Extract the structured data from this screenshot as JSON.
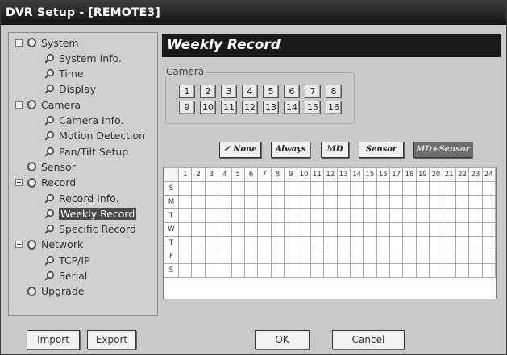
{
  "window": {
    "title": "DVR Setup - [REMOTE3]"
  },
  "tree": {
    "items": [
      {
        "label": "System",
        "level": 0,
        "expander": true,
        "icon": "folder-icon"
      },
      {
        "label": "System Info.",
        "level": 1,
        "icon": "magnifier-icon"
      },
      {
        "label": "Time",
        "level": 1,
        "icon": "magnifier-icon"
      },
      {
        "label": "Display",
        "level": 1,
        "icon": "magnifier-icon"
      },
      {
        "label": "Camera",
        "level": 0,
        "expander": true,
        "icon": "folder-icon"
      },
      {
        "label": "Camera Info.",
        "level": 1,
        "icon": "magnifier-icon"
      },
      {
        "label": "Motion Detection",
        "level": 1,
        "icon": "magnifier-icon"
      },
      {
        "label": "Pan/Tilt Setup",
        "level": 1,
        "icon": "magnifier-icon"
      },
      {
        "label": "Sensor",
        "level": 0,
        "expander": false,
        "icon": "folder-icon"
      },
      {
        "label": "Record",
        "level": 0,
        "expander": true,
        "icon": "folder-icon"
      },
      {
        "label": "Record Info.",
        "level": 1,
        "icon": "magnifier-icon"
      },
      {
        "label": "Weekly Record",
        "level": 1,
        "icon": "magnifier-icon",
        "selected": true
      },
      {
        "label": "Specific Record",
        "level": 1,
        "icon": "magnifier-icon"
      },
      {
        "label": "Network",
        "level": 0,
        "expander": true,
        "icon": "folder-icon"
      },
      {
        "label": "TCP/IP",
        "level": 1,
        "icon": "magnifier-icon"
      },
      {
        "label": "Serial",
        "level": 1,
        "icon": "magnifier-icon"
      },
      {
        "label": "Upgrade",
        "level": 0,
        "expander": false,
        "icon": "folder-icon"
      }
    ]
  },
  "page": {
    "title": "Weekly Record",
    "camera_label": "Camera",
    "cameras": [
      "1",
      "2",
      "3",
      "4",
      "5",
      "6",
      "7",
      "8",
      "9",
      "10",
      "11",
      "12",
      "13",
      "14",
      "15",
      "16"
    ],
    "modes": [
      {
        "label": "None",
        "key": "none",
        "selected": true
      },
      {
        "label": "Always",
        "key": "always"
      },
      {
        "label": "MD",
        "key": "md"
      },
      {
        "label": "Sensor",
        "key": "sensor"
      },
      {
        "label": "MD+Sensor",
        "key": "mdsensor"
      }
    ],
    "hours": [
      "1",
      "2",
      "3",
      "4",
      "5",
      "6",
      "7",
      "8",
      "9",
      "10",
      "11",
      "12",
      "13",
      "14",
      "15",
      "16",
      "17",
      "18",
      "19",
      "20",
      "21",
      "22",
      "23",
      "24"
    ],
    "days": [
      "S",
      "M",
      "T",
      "W",
      "T",
      "F",
      "S"
    ]
  },
  "buttons": {
    "import": "Import",
    "export": "Export",
    "ok": "OK",
    "cancel": "Cancel"
  },
  "colors": {
    "titlebar": "#1a1a1a",
    "header": "#1a1a1a",
    "panel": "#c9c9c9",
    "selected": "#4a4a4a"
  }
}
